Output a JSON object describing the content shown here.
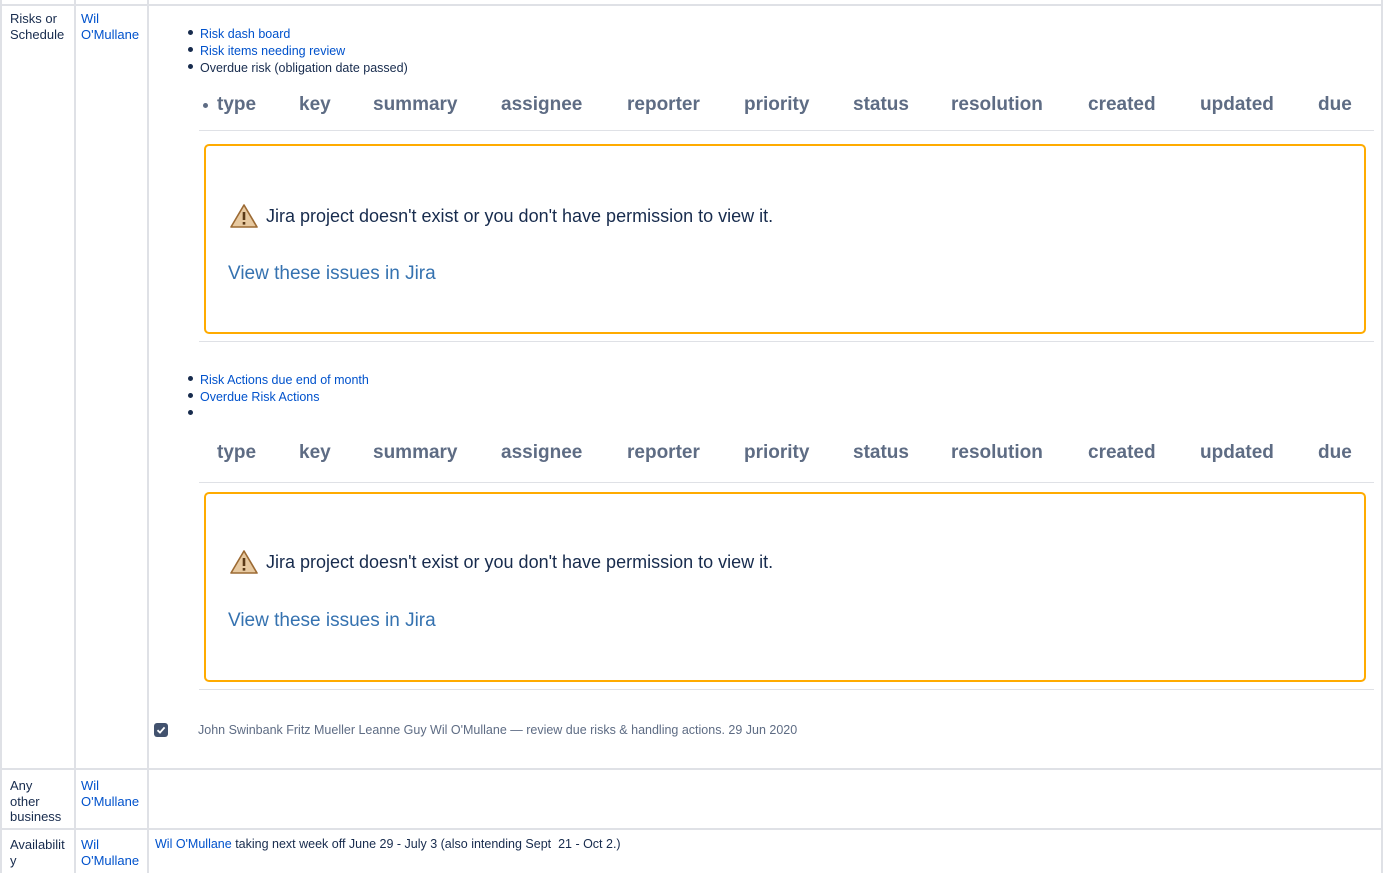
{
  "rows": [
    {
      "item": "Risks or Schedule",
      "owner": "Wil O'Mullane",
      "links_a": [
        "Risk dash board",
        "Risk items needing review"
      ],
      "plain_a": "Overdue risk (obligation date passed)",
      "links_b": [
        "Risk Actions due end of month",
        "Overdue Risk Actions"
      ],
      "jira_columns": [
        "type",
        "key",
        "summary",
        "assignee",
        "reporter",
        "priority",
        "status",
        "resolution",
        "created",
        "updated",
        "due"
      ],
      "jira_error": "Jira project doesn't exist or you don't have permission to view it.",
      "jira_link": "View these issues in Jira",
      "task": {
        "checked": true,
        "text": "John Swinbank Fritz Mueller Leanne Guy Wil O'Mullane  — review due risks & handling actions. 29 Jun 2020"
      }
    },
    {
      "item": "Any other business",
      "owner": "Wil O'Mullane"
    },
    {
      "item": "Availability",
      "owner": "Wil O'Mullane",
      "note_link": "Wil O'Mullane",
      "note_text": " taking next week off June 29 - July 3 (also intending Sept  21 - Oct 2.)"
    }
  ],
  "colors": {
    "link": "#0052cc",
    "warning_border": "#ffab00",
    "warning_icon": "#c68b3f",
    "grid": "#dfe1e6"
  },
  "icons": [
    "warning-icon",
    "checkbox-checked-icon"
  ]
}
